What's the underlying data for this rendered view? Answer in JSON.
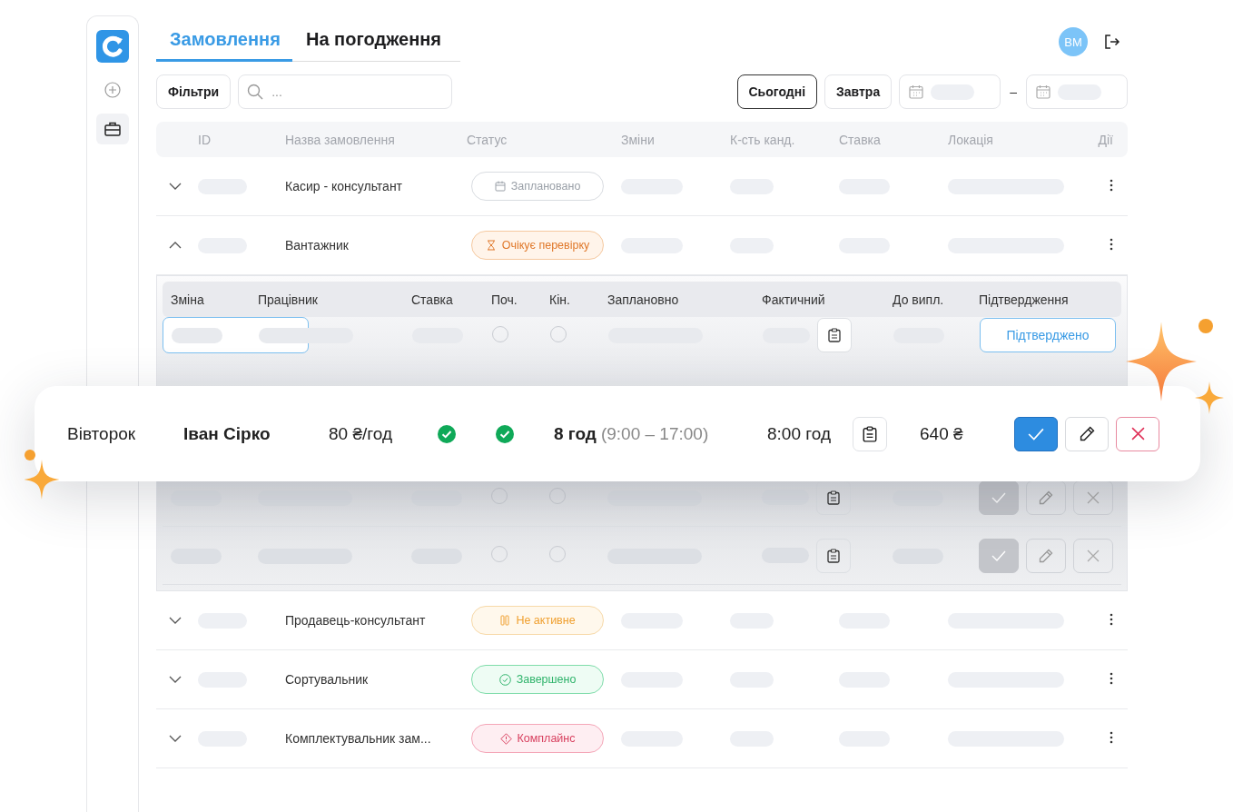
{
  "tabs": [
    {
      "label": "Замовлення",
      "selected": true
    },
    {
      "label": "На погодження",
      "selected": false
    }
  ],
  "user": {
    "initials": "ВМ"
  },
  "toolbar": {
    "filters_button": "Фільтри",
    "search": {
      "placeholder": "..."
    },
    "quick_dates": [
      {
        "label": "Сьогодні",
        "selected": true
      },
      {
        "label": "Завтра",
        "selected": false
      }
    ],
    "date_separator": "–"
  },
  "table": {
    "columns": [
      "ID",
      "Назва замовлення",
      "Статус",
      "Зміни",
      "К-сть канд.",
      "Ставка",
      "Локація",
      "Дії"
    ],
    "rows": [
      {
        "name": "Касир - консультант",
        "status": {
          "label": "Заплановано",
          "kind": "planned"
        },
        "expanded": false
      },
      {
        "name": "Вантажник",
        "status": {
          "label": "Очікує перевірку",
          "kind": "pending"
        },
        "expanded": true,
        "shifts": {
          "columns": [
            "Зміна",
            "Працівник",
            "Ставка",
            "Поч.",
            "Кін.",
            "Заплановно",
            "Фактичний",
            "До випл.",
            "Підтвердження"
          ],
          "rows": [
            {
              "kind": "confirmed",
              "start_checked": false,
              "end_checked": false,
              "confirm_label": "Підтверджено"
            },
            {
              "kind": "hidden"
            },
            {
              "kind": "actions",
              "start_checked": false,
              "end_checked": false
            },
            {
              "kind": "actions",
              "start_checked": false,
              "end_checked": false
            }
          ]
        }
      },
      {
        "name": "Продавець-консультант",
        "status": {
          "label": "Не активне",
          "kind": "inactive"
        },
        "expanded": false
      },
      {
        "name": "Сортувальник",
        "status": {
          "label": "Завершено",
          "kind": "done"
        },
        "expanded": false
      },
      {
        "name": "Комплектувальник зам...",
        "status": {
          "label": "Комплайнс",
          "kind": "compliance"
        },
        "expanded": false
      }
    ]
  },
  "highlighted_shift": {
    "day": "Вівторок",
    "worker": "Іван Сірко",
    "rate": "80 ₴/год",
    "start_checked": true,
    "end_checked": true,
    "planned_hours": "8 год",
    "planned_range": "(9:00 – 17:00)",
    "actual": "8:00 год",
    "payout": "640 ₴"
  }
}
